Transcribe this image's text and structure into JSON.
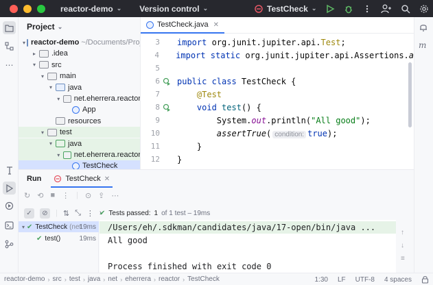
{
  "titlebar": {
    "project": "reactor-demo",
    "vcs": "Version control",
    "run_config": "TestCheck"
  },
  "project_panel": {
    "title": "Project",
    "rows": [
      {
        "label": "reactor-demo",
        "hint": "~/Documents/Projec",
        "depth": 0,
        "arrow": "▾",
        "icon": "folder"
      },
      {
        "label": ".idea",
        "depth": 1,
        "arrow": "▸",
        "icon": "folder-plain"
      },
      {
        "label": "src",
        "depth": 1,
        "arrow": "▾",
        "icon": "folder-plain"
      },
      {
        "label": "main",
        "depth": 2,
        "arrow": "▾",
        "icon": "folder-plain"
      },
      {
        "label": "java",
        "depth": 3,
        "arrow": "▾",
        "icon": "folder"
      },
      {
        "label": "net.eherrera.reactor",
        "depth": 4,
        "arrow": "▾",
        "icon": "package"
      },
      {
        "label": "App",
        "depth": 5,
        "arrow": "",
        "icon": "class"
      },
      {
        "label": "resources",
        "depth": 3,
        "arrow": "",
        "icon": "folder-plain"
      },
      {
        "label": "test",
        "depth": 2,
        "arrow": "▾",
        "icon": "folder-plain"
      },
      {
        "label": "java",
        "depth": 3,
        "arrow": "▾",
        "icon": "folder-test"
      },
      {
        "label": "net.eherrera.reactor",
        "depth": 4,
        "arrow": "▾",
        "icon": "package-test"
      },
      {
        "label": "TestCheck",
        "depth": 5,
        "arrow": "",
        "icon": "class"
      }
    ]
  },
  "editor": {
    "tab_label": "TestCheck.java",
    "lines": [
      {
        "num": "3",
        "gutter": ""
      },
      {
        "num": "4",
        "gutter": ""
      },
      {
        "num": "5",
        "gutter": ""
      },
      {
        "num": "6",
        "gutter": "run"
      },
      {
        "num": "7",
        "gutter": ""
      },
      {
        "num": "8",
        "gutter": "run"
      },
      {
        "num": "9",
        "gutter": ""
      },
      {
        "num": "10",
        "gutter": ""
      },
      {
        "num": "11",
        "gutter": ""
      },
      {
        "num": "12",
        "gutter": ""
      }
    ],
    "code": {
      "l3_kw": "import",
      "l3_rest": " org.junit.jupiter.api.",
      "l3_cls": "Test",
      "l3_end": ";",
      "l4_kw": "import static",
      "l4_rest": " org.junit.jupiter.api.Assertions.",
      "l4_tail": "a",
      "l6_kw": "public class",
      "l6_rest": " TestCheck {",
      "l7_ann": "@Test",
      "l8_kw": "void",
      "l8_fn": "test",
      "l8_rest": "() {",
      "l9_a": "System.",
      "l9_fld": "out",
      "l9_b": ".println(",
      "l9_str": "\"All good\"",
      "l9_c": ");",
      "l10_fn": "assertTrue",
      "l10_open": "(",
      "l10_hint": "condition:",
      "l10_kw": "true",
      "l10_close": ");",
      "l11": "}",
      "l12": "}"
    }
  },
  "run_panel": {
    "title": "Run",
    "tab_label": "TestCheck",
    "status": "Tests passed:",
    "status_detail": "1",
    "status_suffix": "of 1 test – 19ms",
    "results": [
      {
        "label": "TestCheck",
        "extra": "(net",
        "time": "19ms"
      },
      {
        "label": "test()",
        "extra": "",
        "time": "19ms"
      }
    ],
    "console": [
      "/Users/eh/.sdkman/candidates/java/17-open/bin/java ...",
      "All good",
      "",
      "Process finished with exit code 0"
    ]
  },
  "statusbar": {
    "breadcrumbs": [
      "reactor-demo",
      "src",
      "test",
      "java",
      "net",
      "eherrera",
      "reactor",
      "TestCheck"
    ],
    "position": "1:30",
    "line_sep": "LF",
    "encoding": "UTF-8",
    "indent": "4 spaces"
  },
  "colors": {
    "accent": "#3574f0",
    "run_green": "#4aa25f",
    "titlebar_bg": "#27282e"
  }
}
